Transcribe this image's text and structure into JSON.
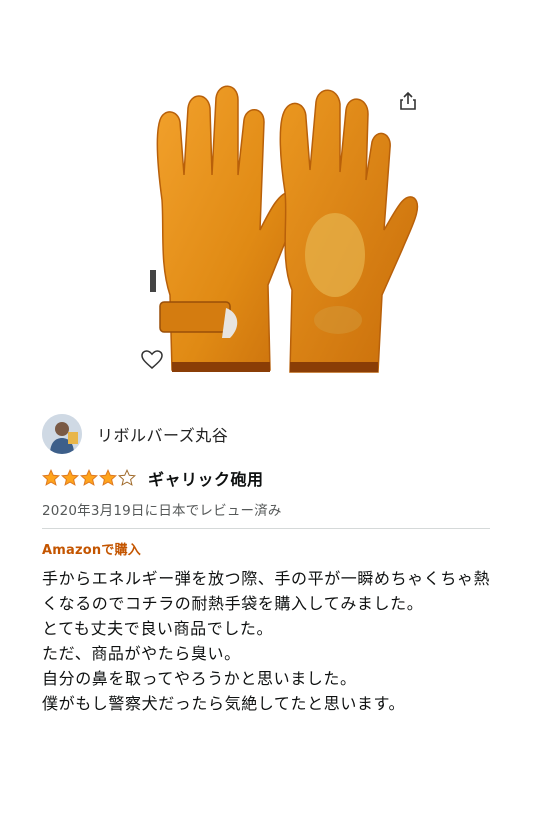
{
  "product": {
    "image": "leather-work-gloves",
    "share_icon": "share-icon",
    "wishlist_icon": "heart-outline-icon"
  },
  "review": {
    "reviewer_name": "リボルバーズ丸谷",
    "rating": 4,
    "rating_max": 5,
    "title": "ギャリック砲用",
    "date": "2020年3月19日に日本でレビュー済み",
    "verified": "Amazonで購入",
    "body": "手からエネルギー弾を放つ際、手の平が一瞬めちゃくちゃ熱くなるのでコチラの耐熱手袋を購入してみました。\nとても丈夫で良い商品でした。\nただ、商品がやたら臭い。\n自分の鼻を取ってやろうかと思いました。\n僕がもし警察犬だったら気絶してたと思います。"
  },
  "colors": {
    "star": "#ffa41c",
    "verified": "#c45500",
    "date": "#565959"
  }
}
